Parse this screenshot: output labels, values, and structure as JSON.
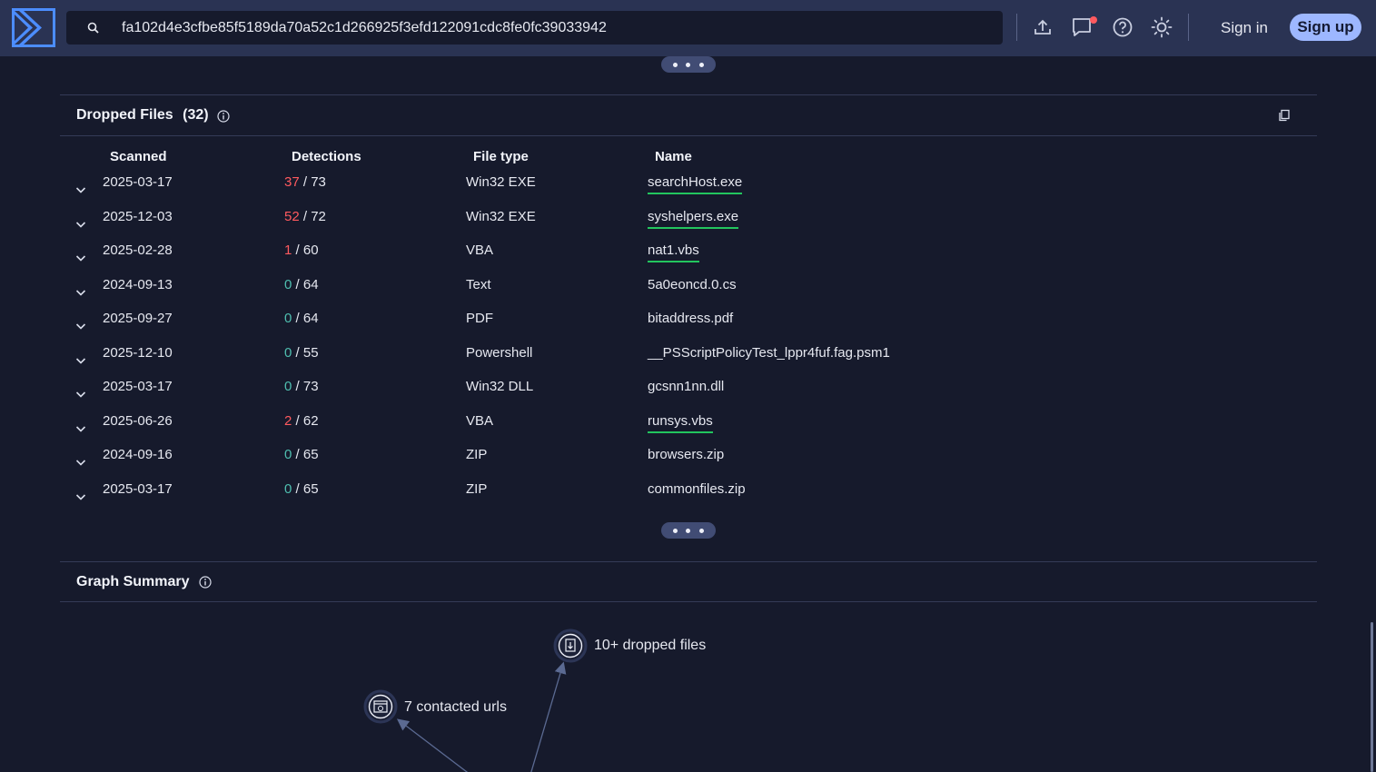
{
  "search": {
    "value": "fa102d4e3cfbe85f5189da70a52c1d266925f3efd122091cdc8fe0fc39033942"
  },
  "header": {
    "sign_in": "Sign in",
    "sign_up": "Sign up"
  },
  "colors": {
    "accent": "#9db7ff",
    "background": "#161a2c",
    "topbar": "#2a3353",
    "detection_bad": "#ff5a5f",
    "detection_ok": "#4fbfb0",
    "verdict_underline": "#22c55e"
  },
  "dropped_files": {
    "title": "Dropped Files",
    "count": "(32)",
    "columns": {
      "scanned": "Scanned",
      "detections": "Detections",
      "file_type": "File type",
      "name": "Name"
    },
    "rows": [
      {
        "scanned": "2025-03-17",
        "positives": "37",
        "total": "/ 73",
        "type": "Win32 EXE",
        "name": "searchHost.exe"
      },
      {
        "scanned": "2025-12-03",
        "positives": "52",
        "total": "/ 72",
        "type": "Win32 EXE",
        "name": "syshelpers.exe"
      },
      {
        "scanned": "2025-02-28",
        "positives": "1",
        "total": "/ 60",
        "type": "VBA",
        "name": "nat1.vbs"
      },
      {
        "scanned": "2024-09-13",
        "positives": "0",
        "total": "/ 64",
        "type": "Text",
        "name": "5a0eoncd.0.cs"
      },
      {
        "scanned": "2025-09-27",
        "positives": "0",
        "total": "/ 64",
        "type": "PDF",
        "name": "bitaddress.pdf"
      },
      {
        "scanned": "2025-12-10",
        "positives": "0",
        "total": "/ 55",
        "type": "Powershell",
        "name": "__PSScriptPolicyTest_lppr4fuf.fag.psm1"
      },
      {
        "scanned": "2025-03-17",
        "positives": "0",
        "total": "/ 73",
        "type": "Win32 DLL",
        "name": "gcsnn1nn.dll"
      },
      {
        "scanned": "2025-06-26",
        "positives": "2",
        "total": "/ 62",
        "type": "VBA",
        "name": "runsys.vbs"
      },
      {
        "scanned": "2024-09-16",
        "positives": "0",
        "total": "/ 65",
        "type": "ZIP",
        "name": "browsers.zip"
      },
      {
        "scanned": "2025-03-17",
        "positives": "0",
        "total": "/ 65",
        "type": "ZIP",
        "name": "commonfiles.zip"
      }
    ]
  },
  "graph_summary": {
    "title": "Graph Summary",
    "nodes": {
      "dropped": "10+ dropped files",
      "urls": "7 contacted urls"
    }
  }
}
